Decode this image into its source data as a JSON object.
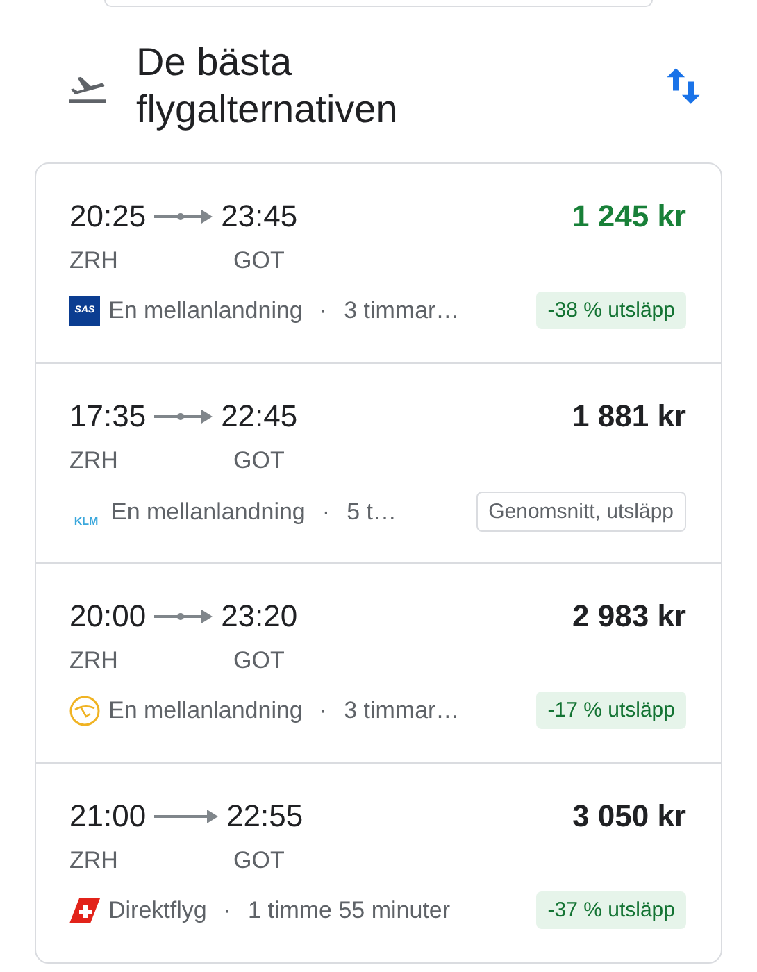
{
  "header": {
    "title": "De bästa flygalternativen"
  },
  "flights": [
    {
      "depart": "20:25",
      "arrive": "23:45",
      "from": "ZRH",
      "to": "GOT",
      "price": "1 245 kr",
      "best_price": true,
      "logo": {
        "kind": "sas",
        "text": "SAS"
      },
      "kind": "one_stop",
      "stops": "En mellanlandning",
      "separator": "·",
      "duration": "3 timmar…",
      "emissions": {
        "kind": "lower",
        "text": "-38 % utsläpp"
      }
    },
    {
      "depart": "17:35",
      "arrive": "22:45",
      "from": "ZRH",
      "to": "GOT",
      "price": "1 881 kr",
      "best_price": false,
      "logo": {
        "kind": "klm",
        "text": "KLM"
      },
      "kind": "one_stop",
      "stops": "En mellanlandning",
      "separator": "·",
      "duration": "5 t…",
      "emissions": {
        "kind": "average",
        "text": "Genomsnitt, utsläpp"
      }
    },
    {
      "depart": "20:00",
      "arrive": "23:20",
      "from": "ZRH",
      "to": "GOT",
      "price": "2 983 kr",
      "best_price": false,
      "logo": {
        "kind": "crane"
      },
      "kind": "one_stop",
      "stops": "En mellanlandning",
      "separator": "·",
      "duration": "3 timmar…",
      "emissions": {
        "kind": "lower",
        "text": "-17 % utsläpp"
      }
    },
    {
      "depart": "21:00",
      "arrive": "22:55",
      "from": "ZRH",
      "to": "GOT",
      "price": "3 050 kr",
      "best_price": false,
      "logo": {
        "kind": "cross"
      },
      "kind": "direct",
      "stops": "Direktflyg",
      "separator": "·",
      "duration": "1 timme 55 minuter",
      "emissions": {
        "kind": "lower",
        "text": "-37 % utsläpp"
      }
    }
  ]
}
